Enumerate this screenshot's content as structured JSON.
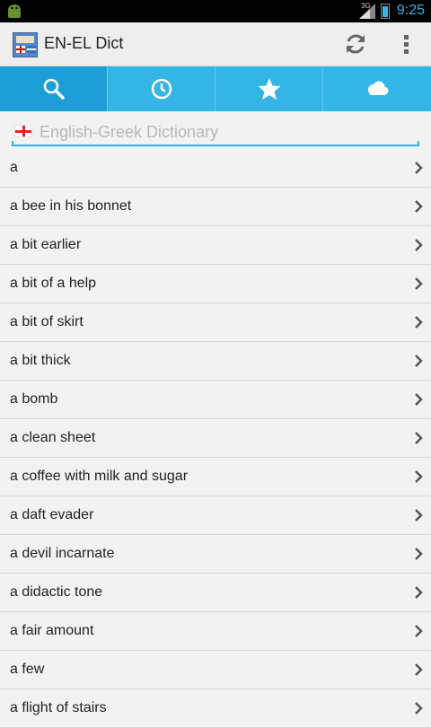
{
  "status_bar": {
    "time": "9:25",
    "network": "3G",
    "icons": [
      "android-icon",
      "signal-icon",
      "battery-icon"
    ]
  },
  "action_bar": {
    "title": "EN-EL Dict",
    "icons": [
      "app-icon",
      "refresh-icon",
      "overflow-menu-icon"
    ]
  },
  "tabs": [
    {
      "icon": "search-icon",
      "active": true
    },
    {
      "icon": "clock-icon",
      "active": false
    },
    {
      "icon": "star-icon",
      "active": false
    },
    {
      "icon": "cloud-icon",
      "active": false
    }
  ],
  "search": {
    "placeholder": "English-Greek Dictionary",
    "value": "",
    "flag_icon": "english-flag-icon"
  },
  "entries": [
    "a",
    "a bee in his bonnet",
    "a bit earlier",
    "a bit of a help",
    "a bit of skirt",
    "a bit thick",
    "a bomb",
    "a clean sheet",
    "a coffee with milk and sugar",
    "a daft evader",
    "a devil incarnate",
    "a didactic tone",
    "a fair amount",
    "a few",
    "a flight of stairs"
  ],
  "colors": {
    "accent": "#33b5e5",
    "active_tab": "#1e9ed6",
    "background": "#f2f2f2"
  }
}
